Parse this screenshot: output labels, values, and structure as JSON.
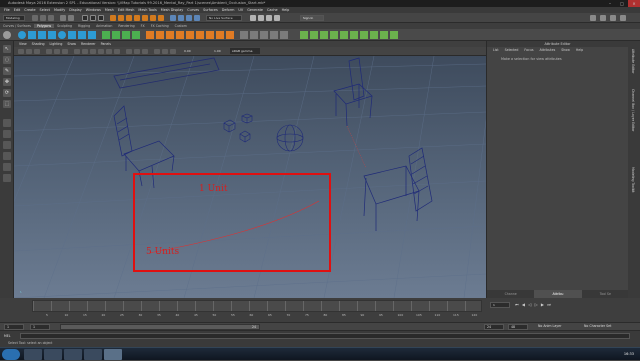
{
  "window": {
    "title": "Autodesk Maya 2016 Extension 2 SP1 - Educational Version: \\\\VMap Tutorials 99.2016_Mental_Ray_Part 1\\scenes\\Ambient_Occlusion_Start.mb*"
  },
  "menubar": [
    "File",
    "Edit",
    "Create",
    "Select",
    "Modify",
    "Display",
    "Windows",
    "Mesh",
    "Edit Mesh",
    "Mesh Tools",
    "Mesh Display",
    "Curves",
    "Surfaces",
    "Deform",
    "UV",
    "Generate",
    "Cache",
    "Help"
  ],
  "status": {
    "mode": "Modeling",
    "no_live_surface": "No Live Surface",
    "sign_in": "Sign In"
  },
  "shelf_tabs": [
    "Curves / Surfaces",
    "Polygons",
    "Sculpting",
    "Rigging",
    "Animation",
    "Rendering",
    "FX",
    "FX Caching",
    "Custom"
  ],
  "shelf_active": "Polygons",
  "viewport_menu": [
    "View",
    "Shading",
    "Lighting",
    "Show",
    "Renderer",
    "Panels"
  ],
  "viewport_toolbar": {
    "value1": "0.00",
    "value2": "1.00",
    "colorspace": "sRGB gamma"
  },
  "viewport": {
    "camera": "persp",
    "annotation_1": "1 Unit",
    "annotation_2": "5 Units",
    "box_color": "#e01010"
  },
  "attribute_editor": {
    "title": "Attribute Editor",
    "menu": [
      "List",
      "Selected",
      "Focus",
      "Attributes",
      "Show",
      "Help"
    ],
    "message": "Make a selection for view attributes",
    "tabs": [
      "Channel Box / Layer Editor",
      "Attribute Editor",
      "Tool Settings"
    ],
    "tabs_short": [
      "Channe",
      "Attribu",
      "Tool Se"
    ],
    "active_tab": "Attribu"
  },
  "sidebar_labels": [
    "Attribute Editor",
    "Channel Box / Layer Editor",
    "Modeling Toolkit"
  ],
  "timeslider": {
    "ticks": [
      "5",
      "10",
      "15",
      "20",
      "25",
      "30",
      "35",
      "40",
      "45",
      "50",
      "55",
      "60",
      "65",
      "70",
      "75",
      "80",
      "85",
      "90",
      "95",
      "100",
      "105",
      "110",
      "115",
      "120"
    ],
    "current_frame": "1"
  },
  "range": {
    "start": "1",
    "play_start": "1",
    "range_label": "24",
    "play_end": "24",
    "end": "48",
    "anim_layer": "No Anim Layer",
    "char_set": "No Character Set"
  },
  "mel_label": "MEL",
  "help_line": "Select Tool: select an object",
  "clock": "16:33"
}
